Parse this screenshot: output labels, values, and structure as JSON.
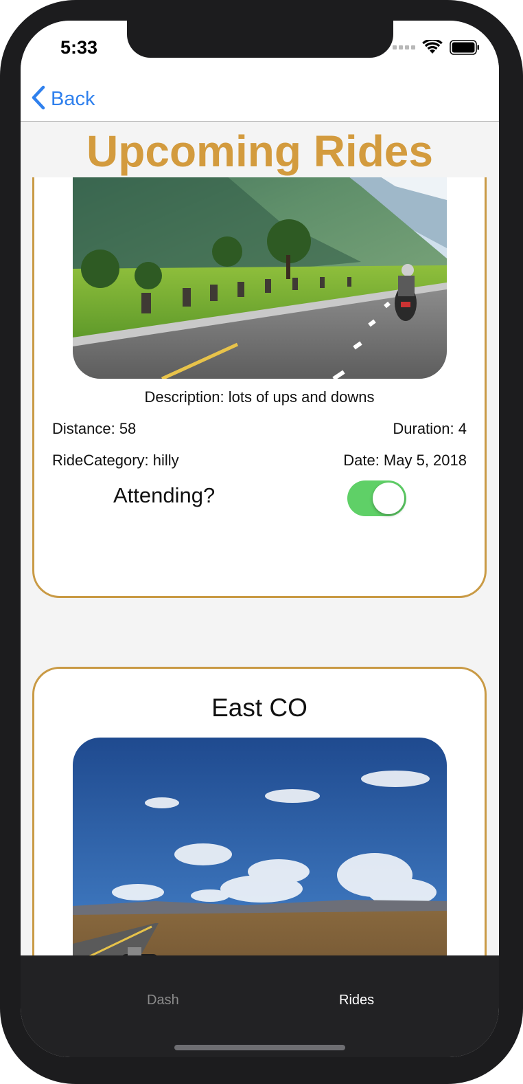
{
  "status_bar": {
    "time": "5:33"
  },
  "nav": {
    "back_label": "Back"
  },
  "page": {
    "title": "Upcoming Rides"
  },
  "rides": [
    {
      "name": "",
      "description": "Description: lots of ups and downs",
      "distance": "Distance: 58",
      "duration": "Duration: 4",
      "category": "RideCategory: hilly",
      "date": "Date: May 5, 2018",
      "attending_label": "Attending?",
      "attending": true
    },
    {
      "name": "East CO"
    }
  ],
  "tabs": [
    {
      "label": "Dash",
      "active": false
    },
    {
      "label": "Rides",
      "active": true
    }
  ],
  "colors": {
    "accent_gold": "#d39b3e",
    "link_blue": "#2f80ed",
    "toggle_on": "#5fd067",
    "tab_bar": "#222224"
  },
  "icons": [
    "chevron-left-icon",
    "cellular-signal-icon",
    "wifi-icon",
    "battery-icon"
  ]
}
